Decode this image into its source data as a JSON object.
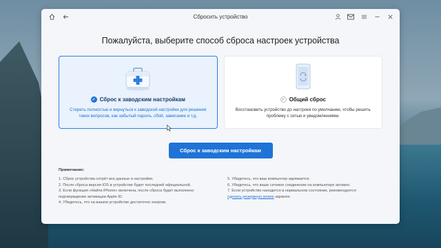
{
  "window": {
    "title": "Сбросить устройство"
  },
  "icons": {
    "home": "home-icon",
    "back": "back-arrow-icon",
    "user": "user-icon",
    "mail": "mail-icon",
    "menu": "menu-icon",
    "minimize": "minimize-icon",
    "close": "close-icon"
  },
  "main": {
    "heading": "Пожалуйста, выберите способ сброса настроек устройства",
    "options": [
      {
        "title": "Сброс к заводским настройкам",
        "description": "Стереть полностью и вернуться к заводской настройки для решения таких вопросов, как забытый пароль, сбой, зависание и т.д.",
        "selected": true,
        "icon": "first-aid-kit-icon"
      },
      {
        "title": "Общий сброс",
        "description": "Восстановить устройство до настроек по умолчанию, чтобы решить проблему с сетью и уведомлениями.",
        "selected": false,
        "icon": "phone-refresh-icon"
      }
    ],
    "action_button": "Сброс к заводским настройкам"
  },
  "notes": {
    "title": "Примечание:",
    "left": [
      "1. Сброс устройства сотрёт все данные и настройки.",
      "2. После сброса версия IOS в устройстве будет последней официальной.",
      "3. Если функция «Найти iPhone» включена, после сброса будет выполнено",
      "подтверждение активации Apple ID.",
      "4. Убедитесь, что на вашем устройстве достаточно энергии."
    ],
    "right": [
      "5. Убедитесь, что ваш компьютер заряжается.",
      "6. Убедитесь, что ваше сетевое соединение на компьютере активно.",
      "7. Если устройство находится в нормальном состоянии, рекомендуется"
    ],
    "right_link": "сделать резервную копию",
    "right_tail": " заранее."
  },
  "colors": {
    "accent": "#1f73d6",
    "selected_bg": "#e9f2fd",
    "window_bg": "#f4f6f9"
  }
}
